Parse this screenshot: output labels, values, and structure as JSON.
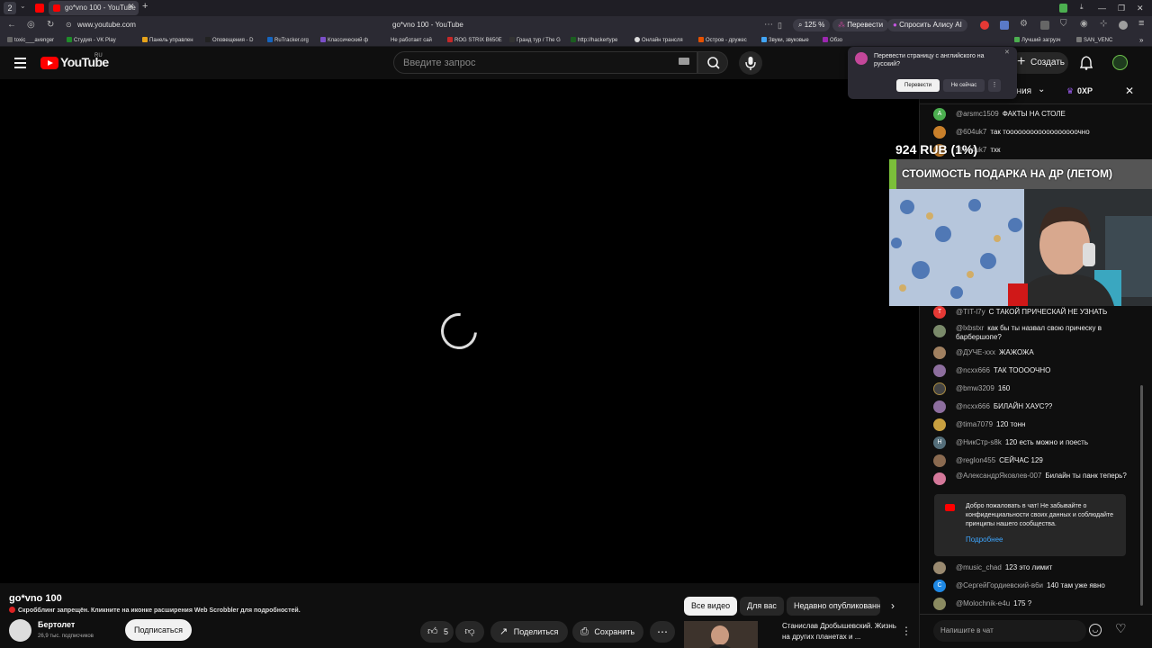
{
  "browser": {
    "workspace": "2",
    "tab_title": "go*vno 100 - YouTube",
    "url": "www.youtube.com",
    "center_title": "go*vno 100 - YouTube",
    "zoom": "125 %",
    "translate_btn": "Перевести",
    "alice_btn": "Спросить Алису AI",
    "bookmarks": [
      "toxic___avenger",
      "Студия - VK Play",
      "Панель управлен",
      "Оповещения - D",
      "RuTracker.org",
      "Классический ф",
      "Не работает сай",
      "ROG STRIX B650E",
      "Гранд тур / The G",
      "http://hackertype",
      "Онлайн трансля",
      "Остров - дружес",
      "Звуки, звуковые",
      "Обзо",
      "Лучший загрузч",
      "SAN_VENC"
    ]
  },
  "translate_popup": {
    "question": "Перевести страницу с английского на русский?",
    "translate": "Перевести",
    "not_now": "Не сейчас",
    "more": "⋮"
  },
  "youtube": {
    "logo_text": "YouTube",
    "region": "RU",
    "search_placeholder": "Введите запрос",
    "create": "Создать"
  },
  "video": {
    "title": "go*vno 100",
    "scrobble_note": "Скробблинг запрещён. Кликните на иконке расширения Web Scrobbler для подробностей.",
    "channel_name": "Бертолет",
    "subscribers": "26,9 тыс. подписчиков",
    "subscribe": "Подписаться",
    "likes": "5",
    "share": "Поделиться",
    "save": "Сохранить"
  },
  "recommend": {
    "chips": [
      "Все видео",
      "Для вас",
      "Недавно опубликованные"
    ],
    "title": "Станислав Дробышевский. Жизнь на других планетах и ..."
  },
  "overlay": {
    "amount": "924 RUB (1%)",
    "banner": "СТОИМОСТЬ ПОДАРКА НА ДР (ЛЕТОМ)"
  },
  "chat": {
    "header_partial": "ения",
    "points": "0XP",
    "messages": [
      {
        "author": "@arsmc1509",
        "text": "ФАКТЫ НА СТОЛЕ",
        "avatar": "A",
        "color": "#4caf50"
      },
      {
        "author": "@604uk7",
        "text": "так тоооооооооооооооооочно",
        "avatar": "",
        "color": "#c87f2a"
      },
      {
        "author": "@604uk7",
        "text": "тхк",
        "avatar": "",
        "color": "#c87f2a"
      },
      {
        "author": "@TIT-l7y",
        "text": "С ТАКОЙ ПРИЧЕСКАЙ НЕ УЗНАТЬ",
        "avatar": "T",
        "color": "#e53935"
      },
      {
        "author": "@lxbstxr",
        "text": "как бы ты назвал свою прическу в барбершопе?",
        "avatar": "",
        "color": "#7a8a6a"
      },
      {
        "author": "@ДУЧЕ-xxx",
        "text": "ЖАЖОЖА",
        "avatar": "",
        "color": "#a08060"
      },
      {
        "author": "@ncxx666",
        "text": "ТАК ТООООЧНО",
        "avatar": "",
        "color": "#8d6e9e"
      },
      {
        "author": "@bmw3209",
        "text": "160",
        "avatar": "",
        "color": "#444"
      },
      {
        "author": "@ncxx666",
        "text": "БИЛАЙН ХАУС??",
        "avatar": "",
        "color": "#8d6e9e"
      },
      {
        "author": "@tima7079",
        "text": "120 тонн",
        "avatar": "",
        "color": "#c9a040"
      },
      {
        "author": "@НикСтр-s8k",
        "text": "120 есть можно и поесть",
        "avatar": "H",
        "color": "#546e7a"
      },
      {
        "author": "@regIon455",
        "text": "СЕЙЧАС 129",
        "avatar": "",
        "color": "#8a6a50"
      },
      {
        "author": "@АлександрЯковлев-007",
        "text": "Билайн ты панк теперь?",
        "avatar": "",
        "color": "#d4789a"
      },
      {
        "author": "@music_chad",
        "text": "123 это лимит",
        "avatar": "",
        "color": "#9a8a70"
      },
      {
        "author": "@СергейГордиевский-в6и",
        "text": "140 там уже явно",
        "avatar": "C",
        "color": "#1e88e5"
      },
      {
        "author": "@Molochnik-e4u",
        "text": "175 ?",
        "avatar": "",
        "color": "#8a8a60"
      }
    ],
    "welcome_text": "Добро пожаловать в чат! Не забывайте о конфиденциальности своих данных и соблюдайте принципы нашего сообщества.",
    "welcome_more": "Подробнее",
    "input_placeholder": "Напишите в чат"
  }
}
